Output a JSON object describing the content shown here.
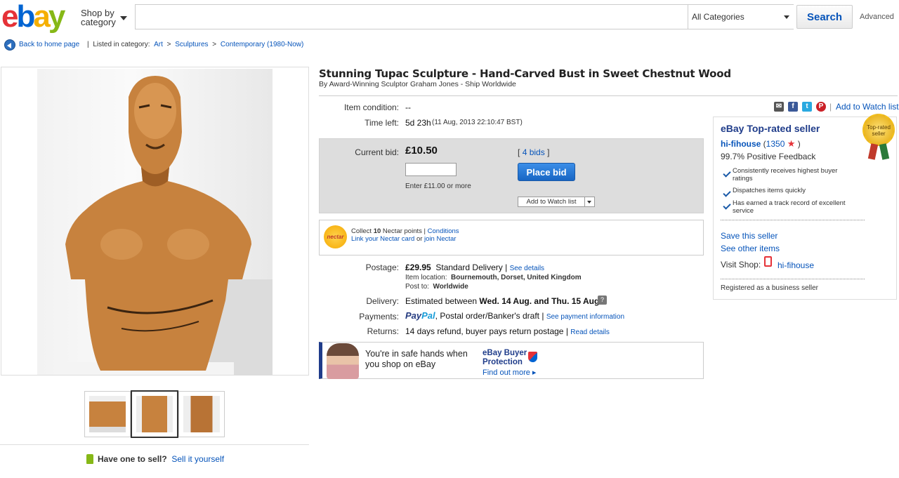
{
  "header": {
    "logo": {
      "e": "e",
      "b": "b",
      "a": "a",
      "y": "y"
    },
    "shop_by": "Shop by",
    "category": "category",
    "search_value": "",
    "category_select": "All Categories",
    "search_button": "Search",
    "advanced": "Advanced"
  },
  "breadcrumb": {
    "back": "Back to home page",
    "listed_in": "Listed in category:",
    "items": [
      "Art",
      "Sculptures",
      "Contemporary (1980-Now)"
    ],
    "separator": ">",
    "bar": "|"
  },
  "item": {
    "title": "Stunning Tupac Sculpture - Hand-Carved Bust in Sweet Chestnut Wood",
    "subtitle": "By Award-Winning Sculptor Graham Jones - Ship Worldwide",
    "condition_label": "Item condition:",
    "condition_value": "--",
    "time_left_label": "Time left:",
    "time_left_value": "5d 23h",
    "time_left_detail": "(11 Aug, 2013  22:10:47 BST)",
    "share_divider": "|",
    "add_watch_link": "Add to Watch list"
  },
  "bid": {
    "current_label": "Current bid:",
    "current_value": "£10.50",
    "bids_open": "[",
    "bids": "4 bids",
    "bids_close": "]",
    "input_value": "",
    "enter_hint": "Enter £11.00 or more",
    "place_bid": "Place bid",
    "watch_button": "Add to Watch list"
  },
  "nectar": {
    "logo": "nectar",
    "collect_pre": "Collect",
    "points": "10",
    "collect_post": "Nectar points",
    "bar": "|",
    "conditions": "Conditions",
    "link_card": "Link your Nectar card",
    "or": "or",
    "join": "join Nectar"
  },
  "shipping": {
    "postage_label": "Postage:",
    "postage_price": "£29.95",
    "postage_service": "Standard Delivery",
    "bar": "|",
    "see_details": "See details",
    "location_label": "Item location:",
    "location": "Bournemouth, Dorset, United Kingdom",
    "post_to_label": "Post to:",
    "post_to": "Worldwide",
    "delivery_label": "Delivery:",
    "delivery_pre": "Estimated between",
    "delivery_dates": "Wed. 14 Aug. and Thu. 15 Aug.",
    "payments_label": "Payments:",
    "paypal_pay": "Pay",
    "paypal_pal": "Pal",
    "payments_other": ", Postal order/Banker's draft",
    "see_payment": "See payment information",
    "returns_label": "Returns:",
    "returns_value": "14 days refund, buyer pays return postage",
    "read_details": "Read details"
  },
  "protection": {
    "line1": "You're in safe hands when",
    "line2": "you shop on eBay",
    "title1": "eBay Buyer",
    "title2": "Protection",
    "find_out": "Find out more ▸"
  },
  "seller": {
    "heading": "eBay Top-rated seller",
    "name": "hi-fihouse",
    "score_open": "(",
    "score": "1350",
    "star": "★",
    "score_close": ")",
    "feedback": "99.7% Positive Feedback",
    "points": [
      "Consistently receives highest buyer ratings",
      "Dispatches items quickly",
      "Has earned a track record of excellent service"
    ],
    "badge": "Top-rated seller",
    "save_seller": "Save this seller",
    "see_other": "See other items",
    "visit_label": "Visit Shop:",
    "shop_name": "hi-fihouse",
    "registered": "Registered as a business seller"
  },
  "sell": {
    "question": "Have one to sell?",
    "link": "Sell it yourself"
  },
  "colors": {
    "link": "#0654ba",
    "place_bid": "#1866c4",
    "nectar": "#f5a800",
    "brand_red": "#e53238"
  },
  "icons": [
    "back-icon",
    "email-icon",
    "facebook-icon",
    "twitter-icon",
    "pinterest-icon",
    "help-icon",
    "shield-icon",
    "shop-icon",
    "tag-icon"
  ]
}
